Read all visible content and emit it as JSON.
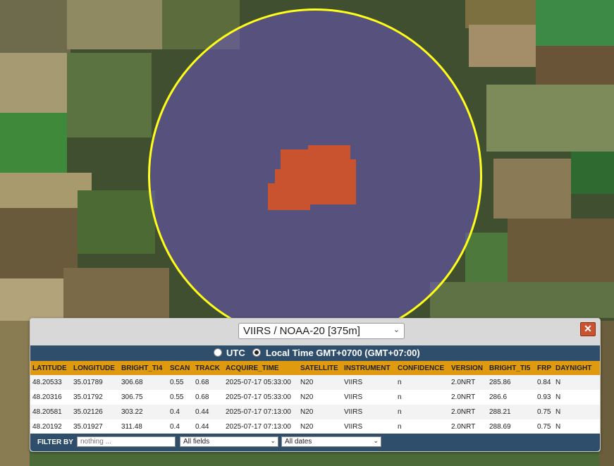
{
  "selector": {
    "selected": "VIIRS / NOAA-20 [375m]"
  },
  "close_label": "✕",
  "timezone": {
    "utc_label": "UTC",
    "local_label": "Local Time GMT+0700 (GMT+07:00)",
    "selected": "local"
  },
  "table": {
    "headers": [
      "LATITUDE",
      "LONGITUDE",
      "BRIGHT_TI4",
      "SCAN",
      "TRACK",
      "ACQUIRE_TIME",
      "SATELLITE",
      "INSTRUMENT",
      "CONFIDENCE",
      "VERSION",
      "BRIGHT_TI5",
      "FRP",
      "DAYNIGHT"
    ],
    "rows": [
      [
        "48.20533",
        "35.01789",
        "306.68",
        "0.55",
        "0.68",
        "2025-07-17 05:33:00",
        "N20",
        "VIIRS",
        "n",
        "2.0NRT",
        "285.86",
        "0.84",
        "N"
      ],
      [
        "48.20316",
        "35.01792",
        "306.75",
        "0.55",
        "0.68",
        "2025-07-17 05:33:00",
        "N20",
        "VIIRS",
        "n",
        "2.0NRT",
        "286.6",
        "0.93",
        "N"
      ],
      [
        "48.20581",
        "35.02126",
        "303.22",
        "0.4",
        "0.44",
        "2025-07-17 07:13:00",
        "N20",
        "VIIRS",
        "n",
        "2.0NRT",
        "288.21",
        "0.75",
        "N"
      ],
      [
        "48.20192",
        "35.01927",
        "311.48",
        "0.4",
        "0.44",
        "2025-07-17 07:13:00",
        "N20",
        "VIIRS",
        "n",
        "2.0NRT",
        "288.69",
        "0.75",
        "N"
      ]
    ]
  },
  "filter": {
    "label": "FILTER BY",
    "placeholder": "nothing ...",
    "fields_selected": "All fields",
    "dates_selected": "All dates"
  },
  "icons": {
    "close": "close-icon",
    "chevron": "chevron-down-icon"
  },
  "colors": {
    "aoi_border": "#ffff1a",
    "hotspot": "#c9532e",
    "header_bar": "#2e4e6c",
    "table_header": "#e09a10"
  }
}
